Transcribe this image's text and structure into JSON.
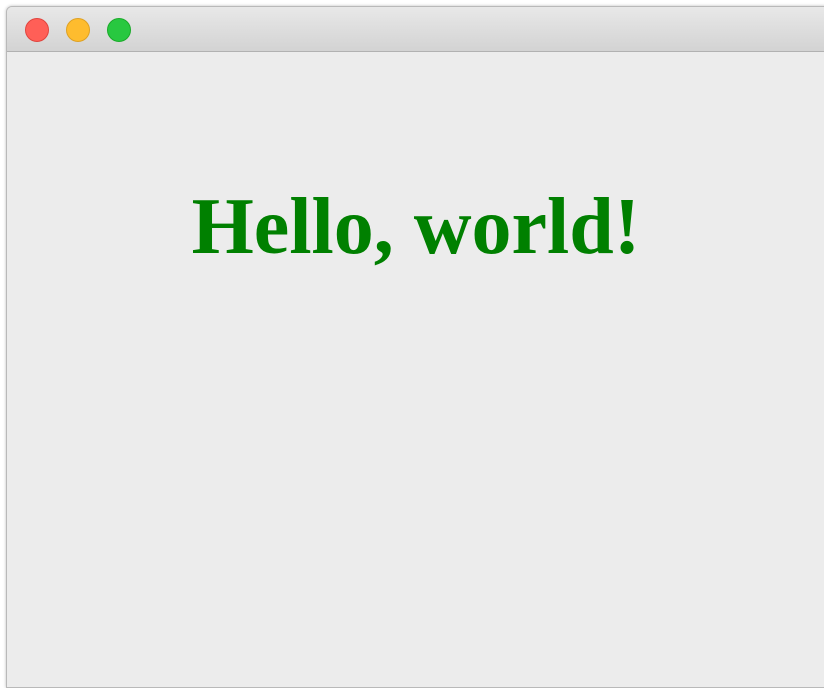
{
  "window": {
    "controls": [
      {
        "id": "close",
        "icon": "close-dot-icon",
        "color": "#ff5f57",
        "border": "#e0443e"
      },
      {
        "id": "minimize",
        "icon": "minimize-dot-icon",
        "color": "#febc2e",
        "border": "#dea123"
      },
      {
        "id": "zoom",
        "icon": "zoom-dot-icon",
        "color": "#28c840",
        "border": "#1aab29"
      }
    ],
    "background": "#ececec"
  },
  "content": {
    "heading": "Hello, world!",
    "heading_color": "#008000"
  }
}
